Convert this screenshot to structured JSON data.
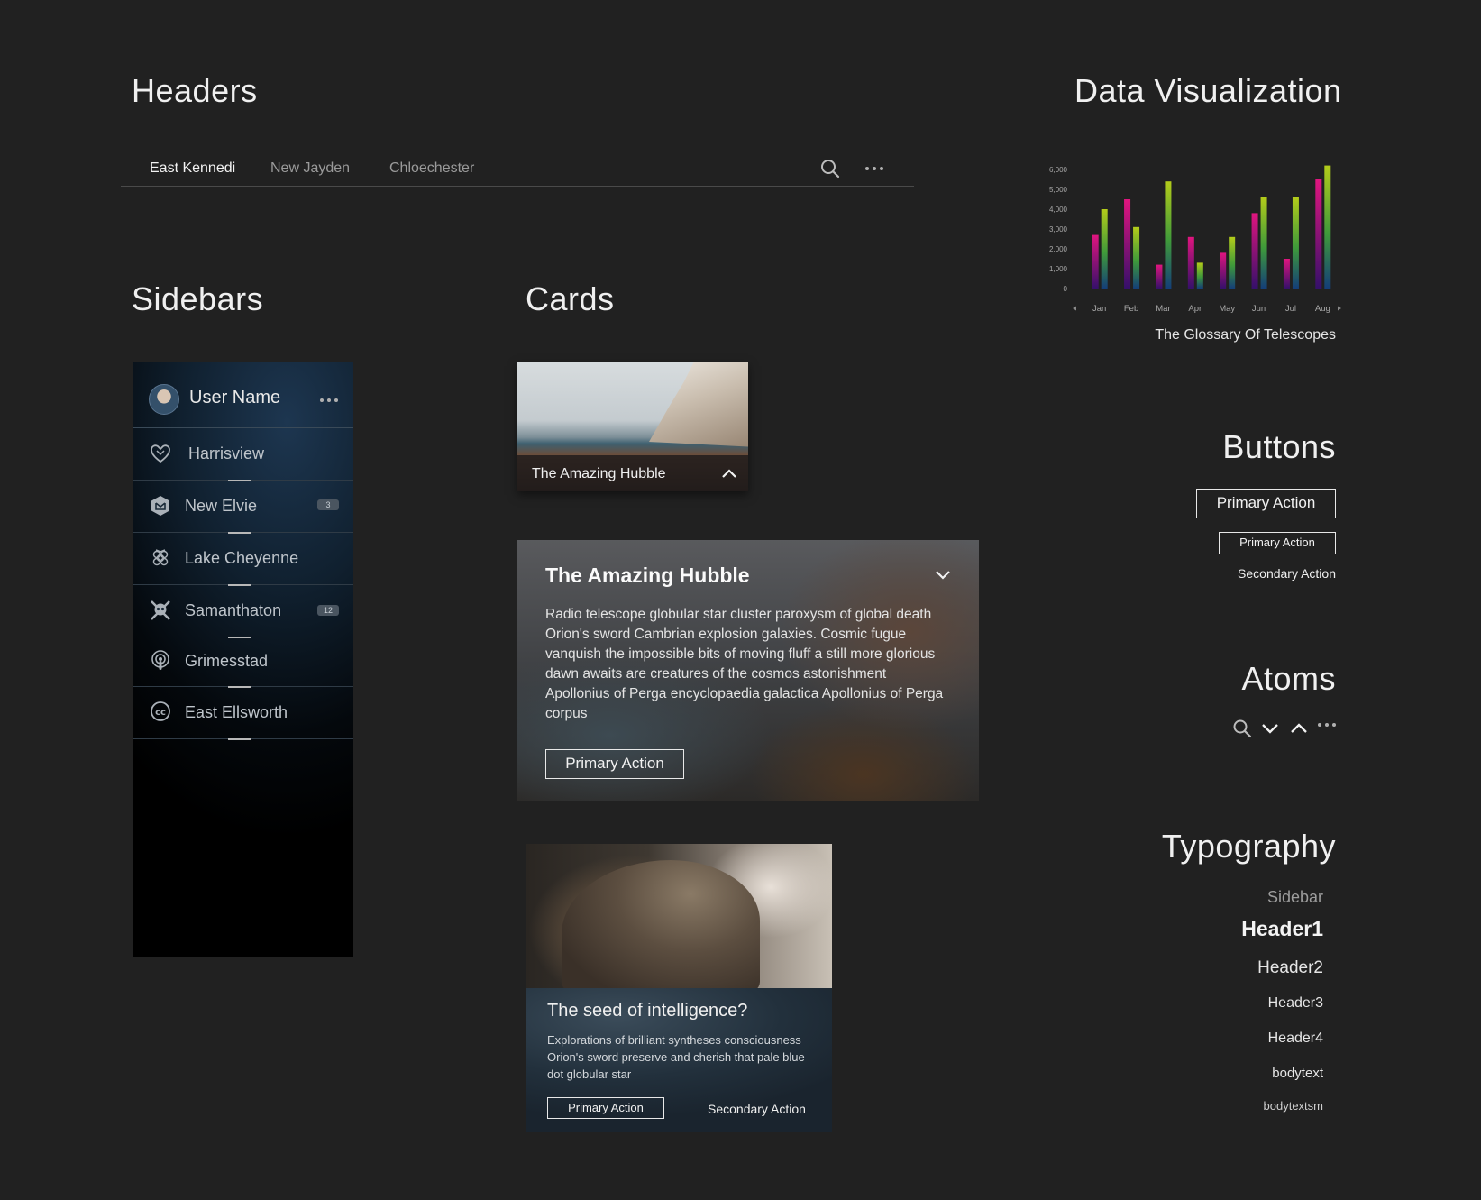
{
  "sections": {
    "headers": "Headers",
    "sidebars": "Sidebars",
    "cards": "Cards",
    "data_visualization": "Data Visualization",
    "buttons": "Buttons",
    "atoms": "Atoms",
    "typography": "Typography"
  },
  "header": {
    "tabs": [
      {
        "label": "East Kennedi",
        "active": true
      },
      {
        "label": "New Jayden",
        "active": false
      },
      {
        "label": "Chloechester",
        "active": false
      }
    ],
    "icons": [
      "search-icon",
      "more-icon"
    ]
  },
  "sidebar": {
    "user_name": "User Name",
    "items": [
      {
        "label": "Harrisview",
        "icon": "heart-shield-icon",
        "badge": ""
      },
      {
        "label": "New Elvie",
        "icon": "hexagon-mail-icon",
        "badge": "3"
      },
      {
        "label": "Lake Cheyenne",
        "icon": "raspberry-icon",
        "badge": ""
      },
      {
        "label": "Samanthaton",
        "icon": "skull-crossbones-icon",
        "badge": "12"
      },
      {
        "label": "Grimesstad",
        "icon": "podcast-icon",
        "badge": ""
      },
      {
        "label": "East Ellsworth",
        "icon": "creative-commons-icon",
        "badge": ""
      }
    ]
  },
  "cards": {
    "card1": {
      "title": "The Amazing Hubble"
    },
    "card2": {
      "title": "The Amazing Hubble",
      "body": "Radio telescope globular star cluster paroxysm of global death Orion's sword Cambrian explosion galaxies. Cosmic fugue vanquish the impossible bits of moving fluff a still more glorious dawn awaits are creatures of the cosmos astonishment Apollonius of Perga encyclopaedia galactica Apollonius of Perga corpus",
      "primary_action": "Primary Action"
    },
    "card3": {
      "title": "The seed of intelligence?",
      "body": "Explorations of brilliant syntheses consciousness Orion's sword preserve and cherish that pale blue dot globular star",
      "primary_action": "Primary Action",
      "secondary_action": "Secondary Action"
    }
  },
  "chart_data": {
    "type": "bar",
    "categories": [
      "Jan",
      "Feb",
      "Mar",
      "Apr",
      "May",
      "Jun",
      "Jul",
      "Aug"
    ],
    "series": [
      {
        "values": [
          2700,
          4500,
          1200,
          2600,
          1800,
          3800,
          1500,
          5500
        ]
      },
      {
        "values": [
          4000,
          3100,
          5400,
          1300,
          2600,
          4600,
          4600,
          6200
        ]
      }
    ],
    "ylim": [
      0,
      6000
    ],
    "yticks": [
      "6,000",
      "5,000",
      "4,000",
      "3,000",
      "2,000",
      "1,000",
      "0"
    ],
    "caption": "The Glossary Of Telescopes",
    "colors": {
      "series1": "#d6157e",
      "series2": "#a8c81c",
      "series_base": "#163a6a"
    }
  },
  "buttons": {
    "primary_large": "Primary Action",
    "primary_small": "Primary Action",
    "secondary": "Secondary Action"
  },
  "atoms": [
    "search-icon",
    "chevron-down-icon",
    "chevron-up-icon",
    "more-icon"
  ],
  "typography": {
    "sidebar": "Sidebar",
    "header1": "Header1",
    "header2": "Header2",
    "header3": "Header3",
    "header4": "Header4",
    "bodytext": "bodytext",
    "bodytextsm": "bodytextsm"
  }
}
